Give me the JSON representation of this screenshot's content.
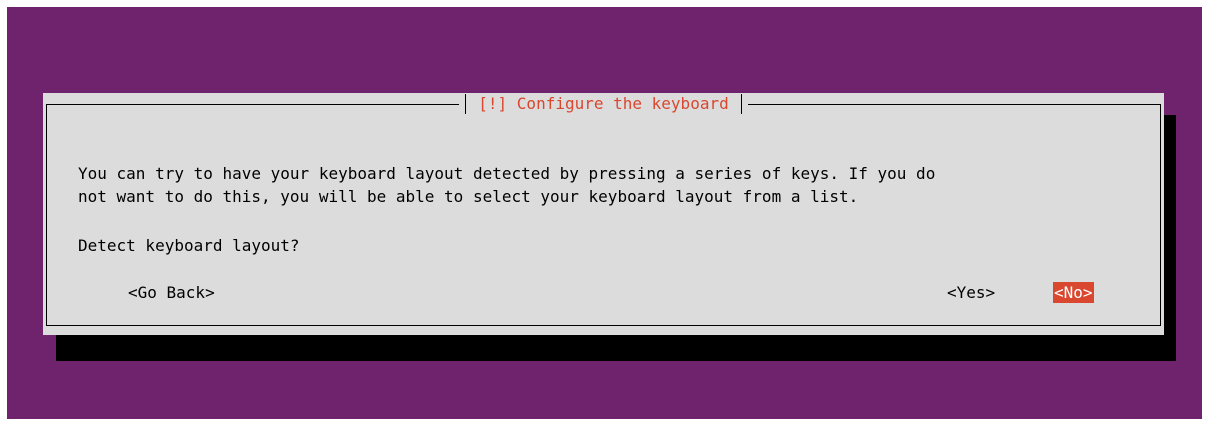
{
  "dialog": {
    "title": "[!] Configure the keyboard",
    "body_lines": [
      "You can try to have your keyboard layout detected by pressing a series of keys. If you do",
      "not want to do this, you will be able to select your keyboard layout from a list."
    ],
    "question": "Detect keyboard layout?"
  },
  "buttons": {
    "back": "<Go Back>",
    "yes": "<Yes>",
    "no": "<No>",
    "selected": "no"
  },
  "colors": {
    "background": "#6e236c",
    "dialog": "#dcdcdc",
    "accent": "#d9472f",
    "shadow": "#000000"
  }
}
